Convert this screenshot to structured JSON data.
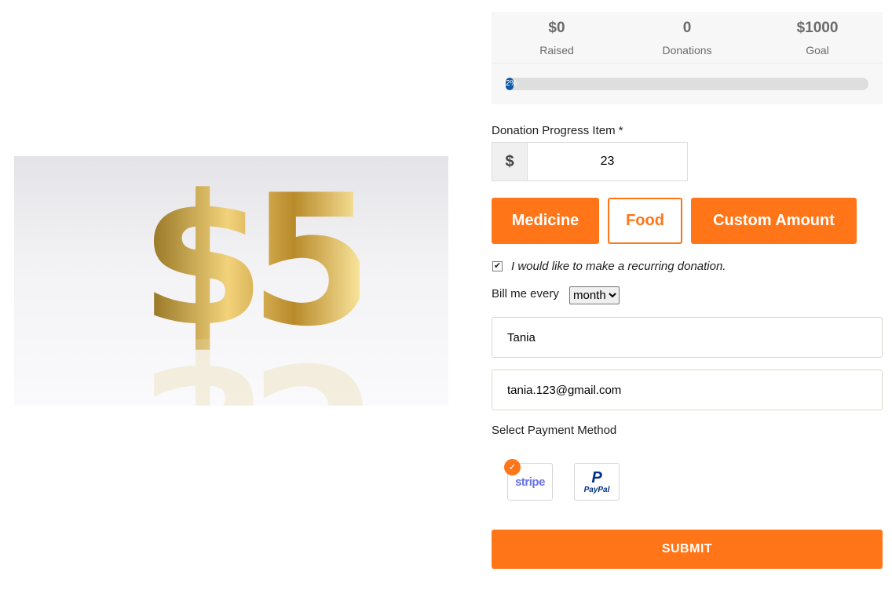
{
  "stats": {
    "raised": {
      "value": "$0",
      "label": "Raised"
    },
    "donations": {
      "value": "0",
      "label": "Donations"
    },
    "goal": {
      "value": "$1000",
      "label": "Goal"
    }
  },
  "progress": {
    "percent": 2,
    "label": "2%",
    "fill_color": "#0d5aa7"
  },
  "amount": {
    "label": "Donation Progress Item *",
    "currency": "$",
    "value": "23"
  },
  "options": [
    {
      "label": "Medicine",
      "selected": true
    },
    {
      "label": "Food",
      "selected": false
    },
    {
      "label": "Custom Amount",
      "selected": true
    }
  ],
  "recurring": {
    "checked": true,
    "label": "I would like to make a recurring donation.",
    "bill_label": "Bill me every",
    "interval": "month"
  },
  "name_value": "Tania",
  "email_value": "tania.123@gmail.com",
  "payment": {
    "label": "Select Payment Method",
    "methods": [
      {
        "name": "stripe",
        "selected": true
      },
      {
        "name": "PayPal",
        "selected": false
      }
    ]
  },
  "submit_label": "SUBMIT",
  "hero_text": "$5",
  "accent": "#ff7518"
}
